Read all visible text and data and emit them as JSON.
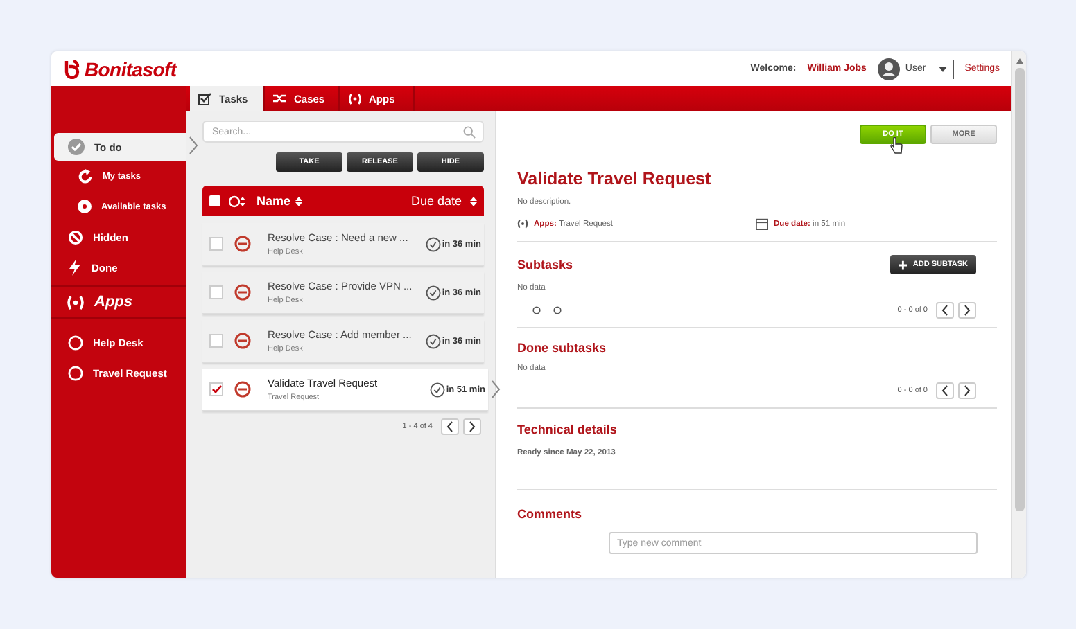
{
  "header": {
    "logo": "Bonitasoft",
    "welcome_label": "Welcome:",
    "user_name": "William Jobs",
    "user_menu": "User",
    "settings": "Settings"
  },
  "tabs": [
    {
      "label": "Tasks",
      "selected": true
    },
    {
      "label": "Cases",
      "selected": false
    },
    {
      "label": "Apps",
      "selected": false
    }
  ],
  "sidebar": {
    "items": [
      {
        "label": "To do",
        "selected": true,
        "children": [
          {
            "label": "My tasks",
            "selected": false
          },
          {
            "label": "Available tasks",
            "selected": false
          }
        ]
      },
      {
        "label": "Hidden",
        "selected": false
      },
      {
        "label": "Done",
        "selected": false
      }
    ],
    "apps_heading": "Apps",
    "apps": [
      {
        "label": "Help Desk",
        "selected": false
      },
      {
        "label": "Travel Request",
        "selected": false
      }
    ]
  },
  "task_list": {
    "search": {
      "placeholder": "Search..."
    },
    "actions": [
      "TAKE",
      "RELEASE",
      "HIDE"
    ],
    "columns": {
      "name": "Name",
      "due_date": "Due date"
    },
    "select_all": {
      "checked": false
    },
    "rows": [
      {
        "name": "Resolve Case : Need a new ...",
        "app": "Help Desk",
        "due": "in 36 min",
        "checked": false,
        "selected": false
      },
      {
        "name": "Resolve Case : Provide VPN ...",
        "app": "Help Desk",
        "due": "in 36 min",
        "checked": false,
        "selected": false
      },
      {
        "name": "Resolve Case : Add member ...",
        "app": "Help Desk",
        "due": "in 36 min",
        "checked": false,
        "selected": false
      },
      {
        "name": "Validate Travel Request",
        "app": "Travel Request",
        "due": "in 51 min",
        "checked": true,
        "selected": true
      }
    ],
    "pagination": "1 - 4 of 4"
  },
  "details": {
    "buttons": [
      {
        "label": "DO IT",
        "kind": "primary"
      },
      {
        "label": "MORE",
        "kind": "secondary"
      }
    ],
    "title": "Validate Travel Request",
    "description": "No description.",
    "apps_label": "Apps:",
    "apps_value": "Travel Request",
    "due_label": "Due date:",
    "due_value": "in 51 min",
    "subtasks": {
      "title": "Subtasks",
      "add_button": "ADD SUBTASK",
      "empty": "No data",
      "pagination": "0 - 0 of 0"
    },
    "done_subtasks": {
      "title": "Done subtasks",
      "empty": "No data",
      "pagination": "0 - 0 of 0"
    },
    "technical": {
      "title": "Technical details",
      "text": "Ready since May 22, 2013"
    },
    "comments": {
      "title": "Comments",
      "placeholder": "Type new comment"
    }
  }
}
